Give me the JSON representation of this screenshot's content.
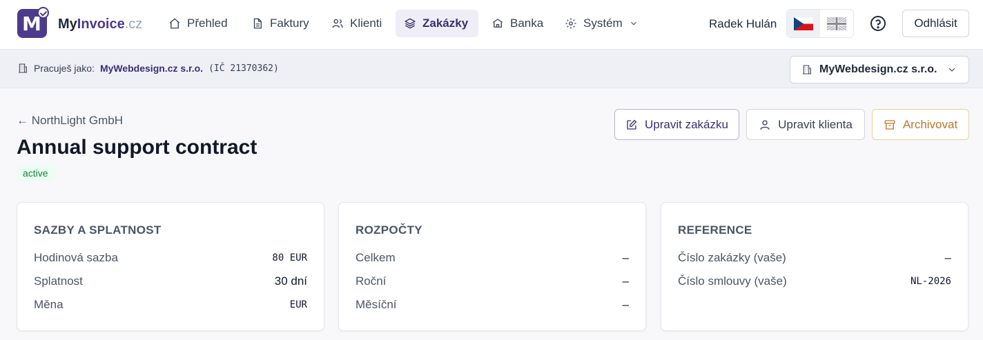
{
  "brand": {
    "name_part1": "My",
    "name_part2": "Invoice",
    "name_part3": ".cz",
    "logo_letter": "M"
  },
  "nav": {
    "items": [
      {
        "label": "Přehled",
        "icon": "home-icon"
      },
      {
        "label": "Faktury",
        "icon": "document-icon"
      },
      {
        "label": "Klienti",
        "icon": "users-icon"
      },
      {
        "label": "Zakázky",
        "icon": "layers-icon"
      },
      {
        "label": "Banka",
        "icon": "bank-icon"
      },
      {
        "label": "Systém",
        "icon": "gear-icon"
      }
    ],
    "active": "Zakázky"
  },
  "user": {
    "name": "Radek Hulán",
    "logout_label": "Odhlásit"
  },
  "languages": [
    "cs",
    "en"
  ],
  "company_bar": {
    "prefix": "Pracuješ jako:",
    "company": "MyWebdesign.cz s.r.o.",
    "ico": "(IČ 21370362)",
    "select_value": "MyWebdesign.cz s.r.o."
  },
  "page": {
    "back_label": "← NorthLight GmbH",
    "title": "Annual support contract",
    "status": "active"
  },
  "actions": {
    "edit_label": "Upravit zakázku",
    "client_label": "Upravit klienta",
    "archive_label": "Archivovat"
  },
  "cards": [
    {
      "title": "SAZBY A SPLATNOST",
      "rows": [
        {
          "label": "Hodinová sazba",
          "value": "80 EUR"
        },
        {
          "label": "Splatnost",
          "value": "30 dní"
        },
        {
          "label": "Měna",
          "value": "EUR"
        }
      ]
    },
    {
      "title": "ROZPOČTY",
      "rows": [
        {
          "label": "Celkem",
          "value": "–"
        },
        {
          "label": "Roční",
          "value": "–"
        },
        {
          "label": "Měsíční",
          "value": "–"
        }
      ]
    },
    {
      "title": "REFERENCE",
      "rows": [
        {
          "label": "Číslo zakázky (vaše)",
          "value": "–"
        },
        {
          "label": "Číslo smlouvy (vaše)",
          "value": "NL-2026"
        }
      ]
    }
  ],
  "colors": {
    "brand": "#4c3a8c",
    "active_nav_bg": "#efeef7",
    "status_green": "#15803d",
    "archive_amber": "#b7792b"
  }
}
